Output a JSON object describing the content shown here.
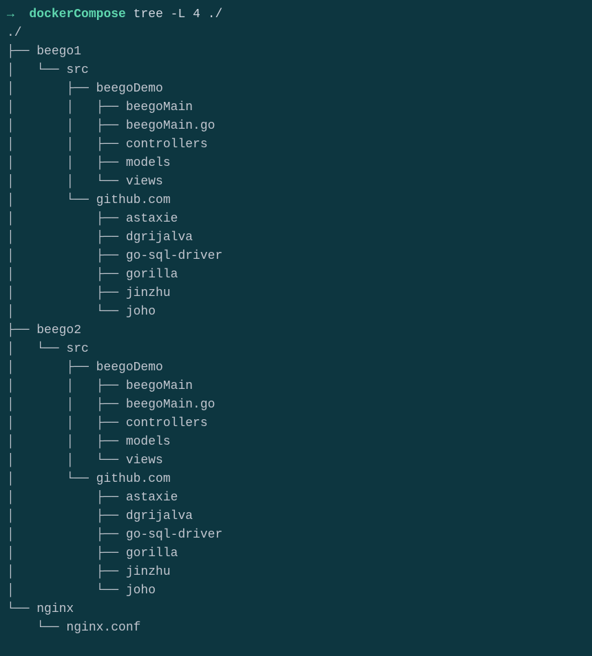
{
  "prompt": {
    "arrow": "→",
    "dir": "dockerCompose",
    "command": "tree -L 4 ./"
  },
  "root": "./",
  "tree": [
    {
      "prefix": "├── ",
      "name": "beego1"
    },
    {
      "prefix": "│   └── ",
      "name": "src"
    },
    {
      "prefix": "│       ├── ",
      "name": "beegoDemo"
    },
    {
      "prefix": "│       │   ├── ",
      "name": "beegoMain"
    },
    {
      "prefix": "│       │   ├── ",
      "name": "beegoMain.go"
    },
    {
      "prefix": "│       │   ├── ",
      "name": "controllers"
    },
    {
      "prefix": "│       │   ├── ",
      "name": "models"
    },
    {
      "prefix": "│       │   └── ",
      "name": "views"
    },
    {
      "prefix": "│       └── ",
      "name": "github.com"
    },
    {
      "prefix": "│           ├── ",
      "name": "astaxie"
    },
    {
      "prefix": "│           ├── ",
      "name": "dgrijalva"
    },
    {
      "prefix": "│           ├── ",
      "name": "go-sql-driver"
    },
    {
      "prefix": "│           ├── ",
      "name": "gorilla"
    },
    {
      "prefix": "│           ├── ",
      "name": "jinzhu"
    },
    {
      "prefix": "│           └── ",
      "name": "joho"
    },
    {
      "prefix": "├── ",
      "name": "beego2"
    },
    {
      "prefix": "│   └── ",
      "name": "src"
    },
    {
      "prefix": "│       ├── ",
      "name": "beegoDemo"
    },
    {
      "prefix": "│       │   ├── ",
      "name": "beegoMain"
    },
    {
      "prefix": "│       │   ├── ",
      "name": "beegoMain.go"
    },
    {
      "prefix": "│       │   ├── ",
      "name": "controllers"
    },
    {
      "prefix": "│       │   ├── ",
      "name": "models"
    },
    {
      "prefix": "│       │   └── ",
      "name": "views"
    },
    {
      "prefix": "│       └── ",
      "name": "github.com"
    },
    {
      "prefix": "│           ├── ",
      "name": "astaxie"
    },
    {
      "prefix": "│           ├── ",
      "name": "dgrijalva"
    },
    {
      "prefix": "│           ├── ",
      "name": "go-sql-driver"
    },
    {
      "prefix": "│           ├── ",
      "name": "gorilla"
    },
    {
      "prefix": "│           ├── ",
      "name": "jinzhu"
    },
    {
      "prefix": "│           └── ",
      "name": "joho"
    },
    {
      "prefix": "└── ",
      "name": "nginx"
    },
    {
      "prefix": "    └── ",
      "name": "nginx.conf"
    }
  ]
}
